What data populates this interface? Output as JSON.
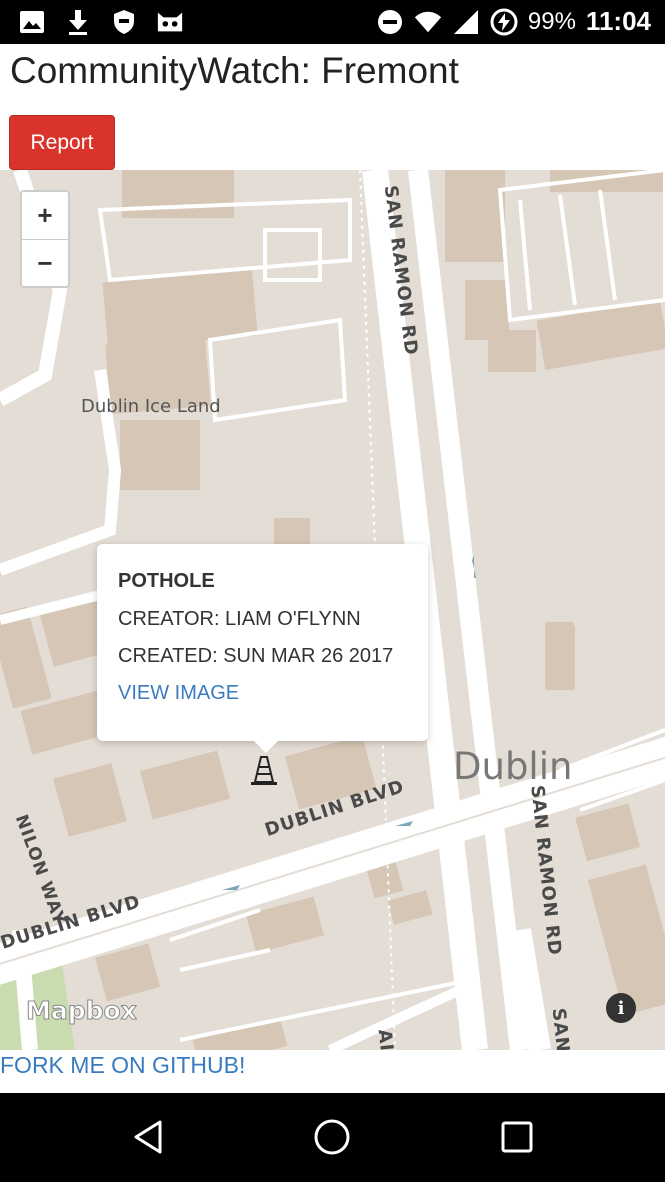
{
  "status_bar": {
    "battery": "99%",
    "time": "11:04",
    "left_icons": [
      "image-icon",
      "download-icon",
      "shield-icon",
      "cat-icon"
    ],
    "right_icons": [
      "do-not-disturb-icon",
      "wifi-icon",
      "signal-icon",
      "battery-charging-icon"
    ]
  },
  "header": {
    "title": "CommunityWatch: Fremont",
    "report_label": "Report"
  },
  "map": {
    "zoom_in": "+",
    "zoom_out": "−",
    "labels": {
      "ice_land": "Dublin Ice Land",
      "dublin": "Dublin",
      "san_ramon_top": "SAN RAMON RD",
      "san_ramon_bottom": "SAN RAMON RD",
      "san_ramon_edge": "SAN",
      "dublin_blvd_right": "DUBLIN BLVD",
      "dublin_blvd_left": "DUBLIN BLVD",
      "dillon_way": "NILON WAY",
      "partial_ai": "AI"
    },
    "attribution": "Mapbox",
    "info": "i",
    "popup": {
      "title": "POTHOLE",
      "creator": "CREATOR: LIAM O'FLYNN",
      "created": "CREATED: SUN MAR 26 2017",
      "view_image": "VIEW IMAGE"
    }
  },
  "footer": {
    "github_link": "FORK ME ON GITHUB!"
  },
  "colors": {
    "report_button": "#d9342b",
    "link": "#3a7bbf",
    "map_land": "#e4ddd5",
    "map_road": "#ffffff",
    "map_building": "#d6c6b5"
  }
}
